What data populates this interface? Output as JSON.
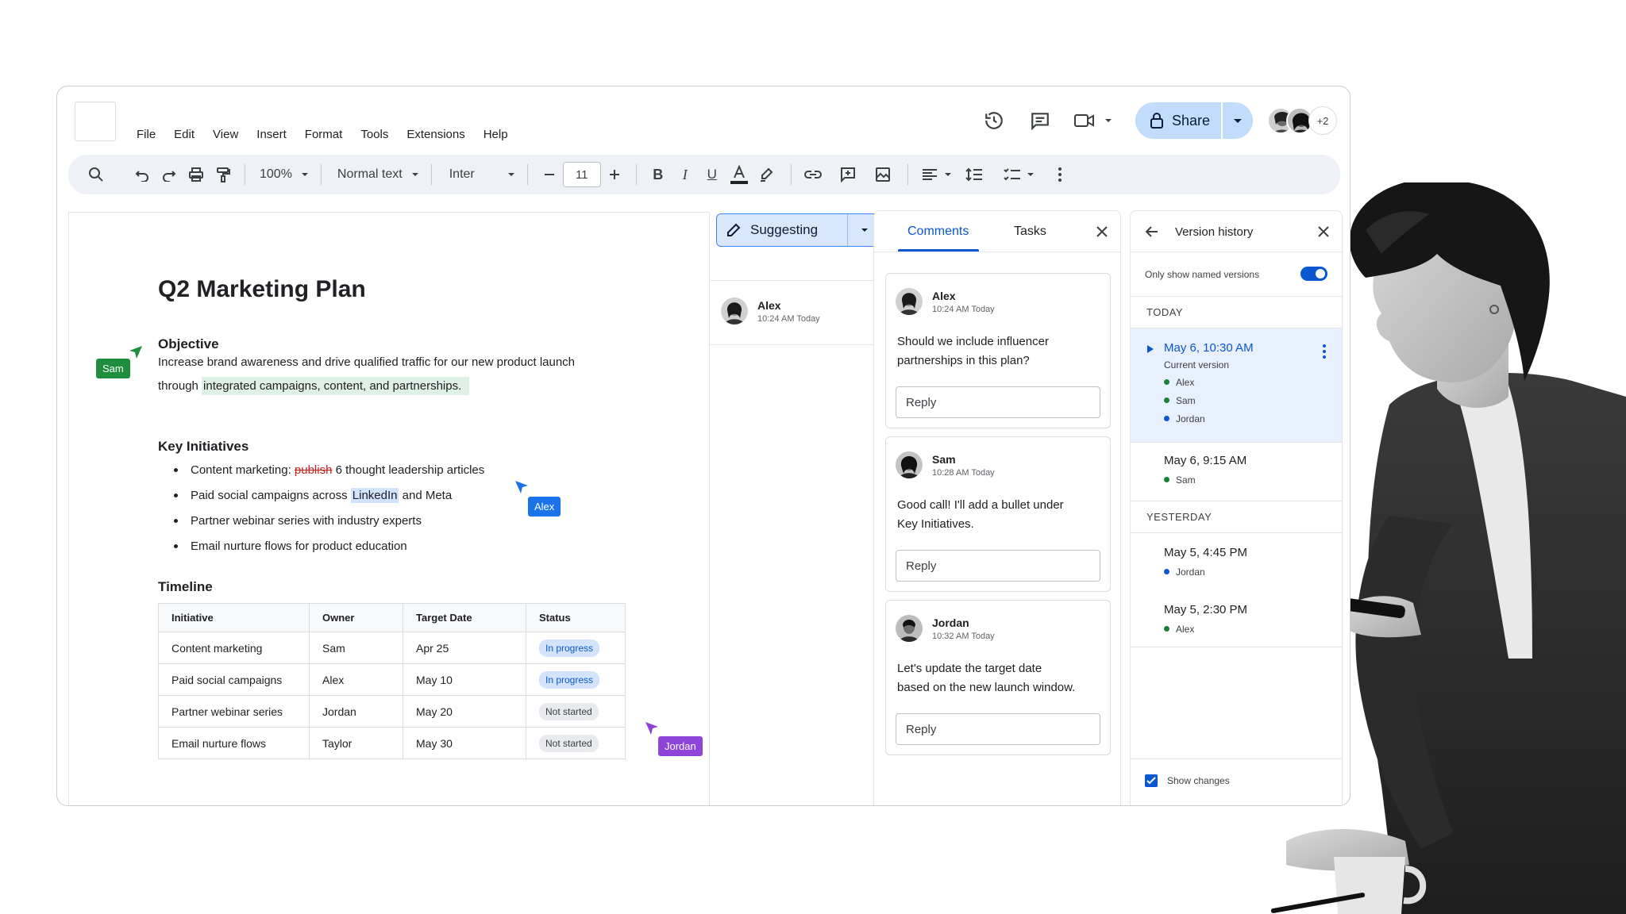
{
  "menu": [
    "File",
    "Edit",
    "View",
    "Insert",
    "Format",
    "Tools",
    "Extensions",
    "Help"
  ],
  "topbar": {
    "share_label": "Share",
    "collaborators_more": "+2"
  },
  "toolbar": {
    "zoom": "100%",
    "style": "Normal text",
    "font": "Inter",
    "font_size": "11"
  },
  "document": {
    "title": "Q2 Marketing Plan",
    "objective_heading": "Objective",
    "objective_line1": "Increase brand awareness and drive qualified traffic for our new product launch",
    "objective_line2_prefix": "through ",
    "objective_highlight": "integrated campaigns, content, and partnerships.",
    "initiatives_heading": "Key Initiatives",
    "bullet1_prefix": "Content marketing: ",
    "bullet1_deleted": "publish",
    "bullet1_suffix": " 6 thought leadership articles",
    "bullet2_prefix": "Paid social campaigns across ",
    "bullet2_highlight": "LinkedIn",
    "bullet2_suffix": " and Meta",
    "bullet3": "Partner webinar series with industry experts",
    "bullet4": "Email nurture flows for product education",
    "timeline_heading": "Timeline",
    "table_headers": [
      "Initiative",
      "Owner",
      "Target Date",
      "Status"
    ],
    "table_rows": [
      [
        "Content marketing",
        "Sam",
        "Apr 25",
        "In progress"
      ],
      [
        "Paid social campaigns",
        "Alex",
        "May 10",
        "In progress"
      ],
      [
        "Partner webinar series",
        "Jordan",
        "May 20",
        "Not started"
      ],
      [
        "Email nurture flows",
        "Taylor",
        "May 30",
        "Not started"
      ]
    ]
  },
  "cursors": {
    "sam": "Sam",
    "alex": "Alex",
    "jordan": "Jordan"
  },
  "suggesting": {
    "label": "Suggesting",
    "user": "Alex",
    "time": "10:24 AM Today"
  },
  "comments_panel": {
    "tab_comments": "Comments",
    "tab_tasks": "Tasks",
    "cards": [
      {
        "name": "Alex",
        "time": "10:24 AM Today",
        "text_line1": "Should we include influencer",
        "text_line2": "partnerships in this plan?",
        "reply": "Reply"
      },
      {
        "name": "Sam",
        "time": "10:28 AM Today",
        "text_line1": "Good call! I'll add a bullet under",
        "text_line2": "Key Initiatives.",
        "reply": "Reply"
      },
      {
        "name": "Jordan",
        "time": "10:32 AM Today",
        "text_line1": "Let's update the target date",
        "text_line2": "based on the new launch window.",
        "reply": "Reply"
      }
    ]
  },
  "version_history": {
    "title": "Version history",
    "named_only": "Only show named versions",
    "today_label": "TODAY",
    "yesterday_label": "YESTERDAY",
    "v1_date": "May 6, 10:30 AM",
    "v1_sub": "Current version",
    "v1_users": [
      "Alex",
      "Sam",
      "Jordan"
    ],
    "v2_date": "May 6, 9:15 AM",
    "v2_user": "Sam",
    "v3_date": "May 5, 4:45 PM",
    "v3_user": "Jordan",
    "v4_date": "May 5, 2:30 PM",
    "v4_user": "Alex",
    "show_changes": "Show changes"
  },
  "colors": {
    "accent": "#0b57d0",
    "sam_cursor": "#1e8e3e",
    "alex_cursor": "#1a73e8",
    "jordan_cursor": "#8e44d8",
    "share_bg": "#c2dcfb"
  }
}
